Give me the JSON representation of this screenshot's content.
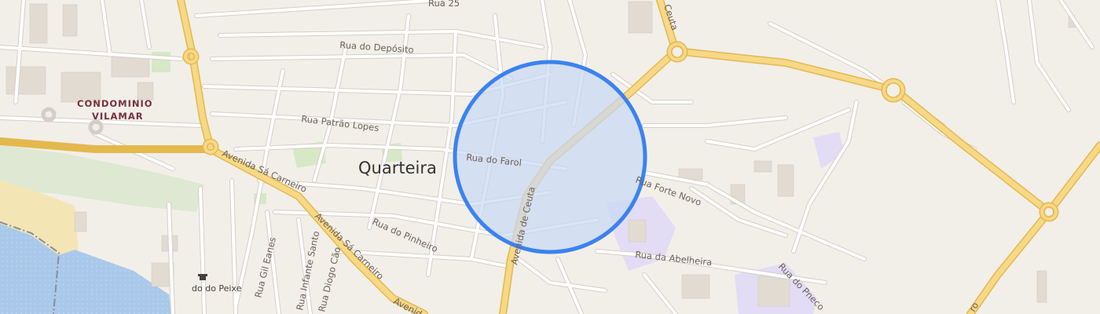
{
  "map": {
    "place_name": "Quarteira",
    "condominium_name_line1": "CONDOMINIO",
    "condominium_name_line2": "VILAMAR",
    "streets": {
      "rua_25": "Rua 25",
      "rua_do_deposito": "Rua do Depósito",
      "rua_patrao_lopes": "Rua Patrão Lopes",
      "rua_do_farol": "Rua do Farol",
      "rua_forte_novo": "Rua Forte Novo",
      "rua_do_pinheiro": "Rua do Pinheiro",
      "avenida_de_ceuta": "Avenida de Ceuta",
      "ceuta_top": "Ceuta",
      "avenida_sa_carneiro": "Avenida Sá Carneiro",
      "avenida_sa_carneiro_2": "Avenida Sá Carneiro",
      "avenida_bottom": "Avenid",
      "rua_da_abelheira": "Rua da Abelheira",
      "rua_do_pneco": "Rua do Pneco",
      "rua_gil_eanes": "Rua Gil Eanes",
      "rua_infante_santo": "Rua Infante Santo",
      "rua_diogo_cao": "Rua Diogo Cão",
      "road_edge_right": "ro"
    },
    "poi": {
      "fish_market_label": "do do Peixe",
      "fish_market_icon": "shop-icon"
    },
    "selection_circle": {
      "fill_color": "#c8d9f3",
      "stroke_color": "#3b82f0"
    },
    "colors": {
      "background": "#f2efe9",
      "major_road": "#f6d887",
      "major_road_casing": "#e3b84d",
      "minor_road": "#ffffff",
      "minor_road_casing": "#d4cec6",
      "water": "#a9c9ea",
      "sand": "#f4e6b4",
      "park": "#d6e8c6",
      "building": "#e1dbd2",
      "school_zone": "#e3dcf5"
    }
  }
}
